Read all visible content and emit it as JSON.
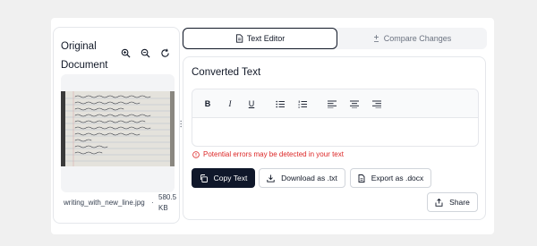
{
  "left_panel": {
    "title": "Original Document",
    "tools": [
      "zoom-in-icon",
      "zoom-out-icon",
      "rotate-icon"
    ],
    "file": {
      "name": "writing_with_new_line.jpg",
      "separator": "·",
      "size": "580.5 KB"
    }
  },
  "tabs": [
    {
      "label": "Text Editor",
      "icon": "document-icon",
      "active": true
    },
    {
      "label": "Compare Changes",
      "icon": "compare-icon",
      "active": false
    }
  ],
  "converted": {
    "title": "Converted Text",
    "toolbar": [
      "bold",
      "italic",
      "underline",
      "bullet-list",
      "numbered-list",
      "align-left",
      "align-center",
      "align-right"
    ],
    "editor_text": "",
    "warning": "Potential errors may be detected in your text",
    "buttons": {
      "copy": "Copy Text",
      "download": "Download as .txt",
      "export": "Export as .docx",
      "share": "Share"
    }
  },
  "colors": {
    "primary": "#0f172a",
    "warning": "#dc2626",
    "border": "#e5e7eb",
    "background": "#f0f0f0"
  }
}
